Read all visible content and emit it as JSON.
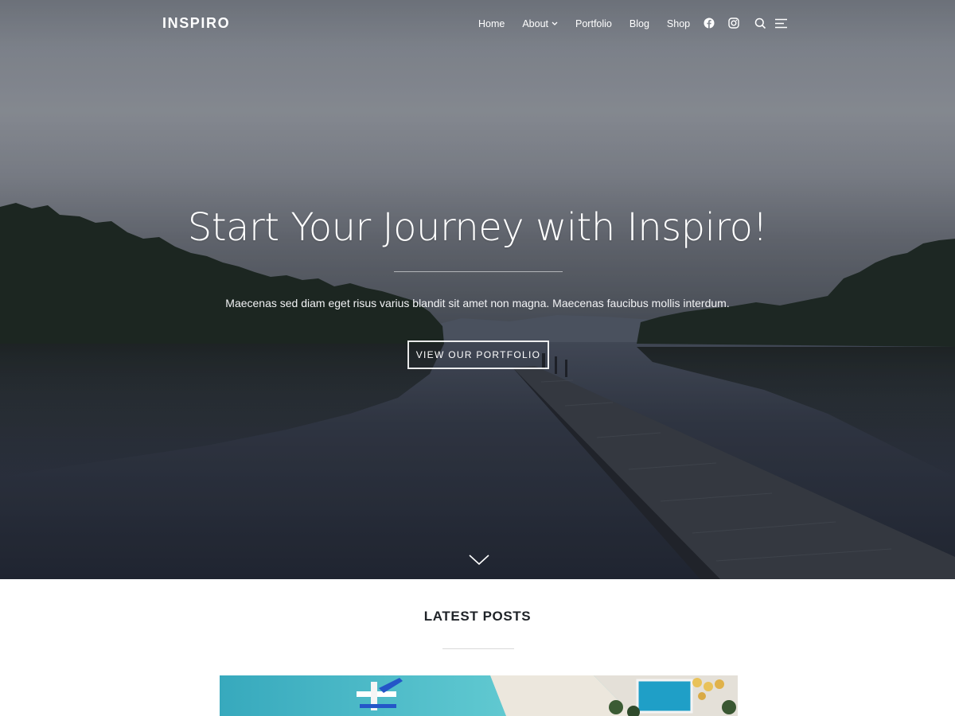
{
  "header": {
    "logo": "INSPIRO",
    "nav": [
      {
        "label": "Home"
      },
      {
        "label": "About",
        "has_dropdown": true
      },
      {
        "label": "Portfolio"
      },
      {
        "label": "Blog"
      },
      {
        "label": "Shop"
      }
    ],
    "icons": [
      "facebook-icon",
      "instagram-icon",
      "search-icon",
      "sidebar-menu-icon",
      "chevron-down-icon"
    ]
  },
  "hero": {
    "title": "Start Your Journey with Inspiro!",
    "subtitle": "Maecenas sed diam eget risus varius blandit sit amet non magna. Maecenas faucibus mollis interdum.",
    "button_label": "VIEW OUR PORTFOLIO",
    "scroll_icon": "chevron-down-icon"
  },
  "latest_posts": {
    "title": "LATEST POSTS"
  },
  "colors": {
    "header_text": "#ffffff",
    "section_title": "#1f2328",
    "water": "#2d3441",
    "sand": "#ece7dd",
    "sea": "#3fb5c6"
  }
}
